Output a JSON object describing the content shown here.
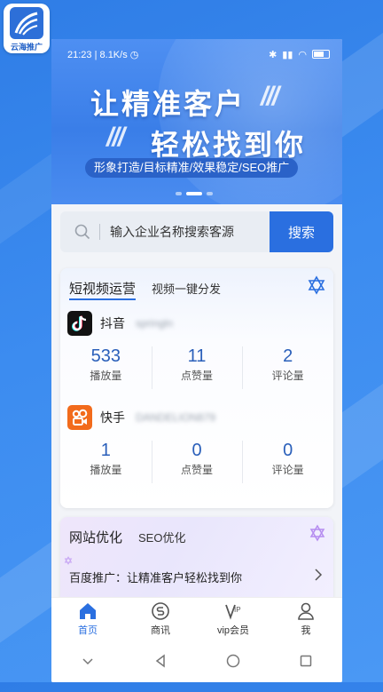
{
  "app": {
    "badge_text": "云海推广"
  },
  "status_bar": {
    "time": "21:23",
    "speed": "8.1K/s"
  },
  "banner": {
    "headline_1": "让精准客户",
    "headline_2": "轻松找到你",
    "slashes": "///",
    "tagline": "形象打造/目标精准/效果稳定/SEO推广"
  },
  "search": {
    "placeholder": "输入企业名称搜索客源",
    "button": "搜索"
  },
  "video_card": {
    "title": "短视频运营",
    "subtitle": "视频一键分发",
    "platforms": [
      {
        "name": "抖音",
        "account": "springln",
        "stats": [
          {
            "value": "533",
            "label": "播放量"
          },
          {
            "value": "11",
            "label": "点赞量"
          },
          {
            "value": "2",
            "label": "评论量"
          }
        ]
      },
      {
        "name": "快手",
        "account": "DANDELION879",
        "stats": [
          {
            "value": "1",
            "label": "播放量"
          },
          {
            "value": "0",
            "label": "点赞量"
          },
          {
            "value": "0",
            "label": "评论量"
          }
        ]
      }
    ]
  },
  "seo_card": {
    "title": "网站优化",
    "subtitle": "SEO优化",
    "line": "百度推广：让精准客户轻松找到你"
  },
  "bottom_nav": [
    {
      "label": "首页",
      "icon": "home-icon",
      "active": true
    },
    {
      "label": "商讯",
      "icon": "news-icon",
      "active": false
    },
    {
      "label": "vip会员",
      "icon": "vip-icon",
      "active": false
    },
    {
      "label": "我",
      "icon": "profile-icon",
      "active": false
    }
  ],
  "colors": {
    "primary": "#2a6fe0",
    "stat_value": "#2a5fba",
    "background": "#3c8cf0"
  }
}
